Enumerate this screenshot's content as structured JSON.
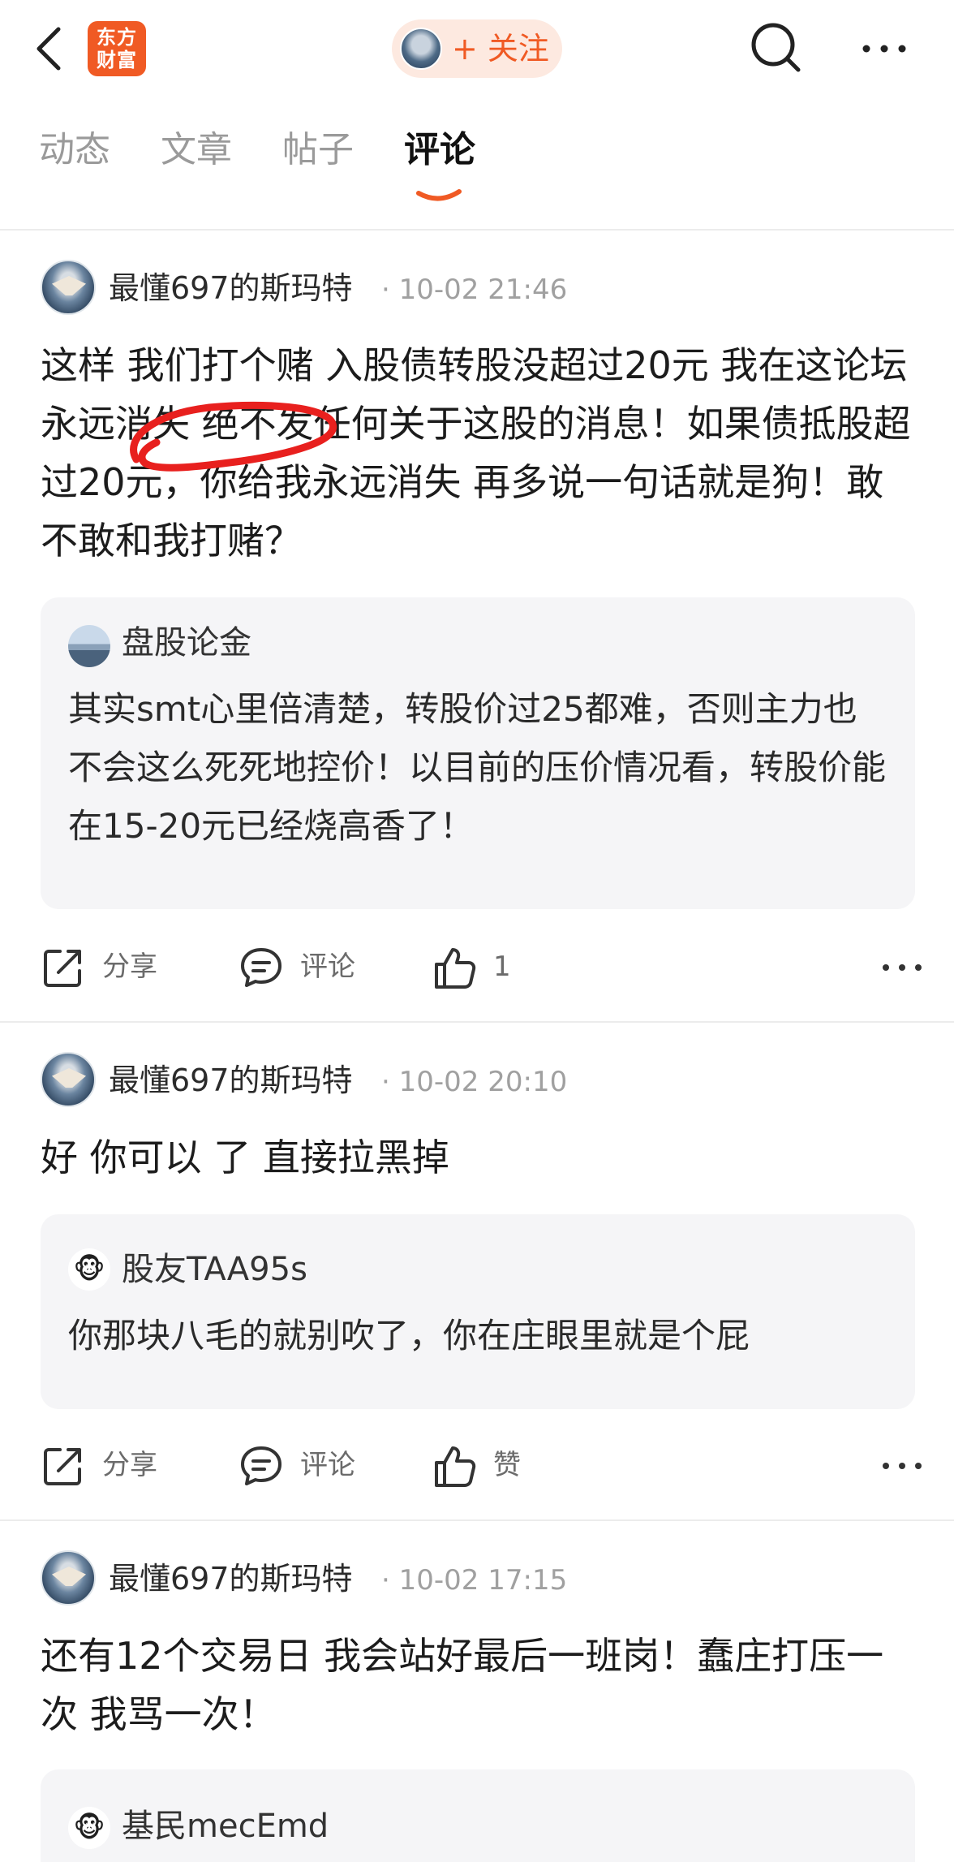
{
  "header": {
    "logo_text_line1": "东方",
    "logo_text_line2": "财富",
    "follow_label": "+ 关注"
  },
  "tabs": [
    {
      "label": "动态"
    },
    {
      "label": "文章"
    },
    {
      "label": "帖子"
    },
    {
      "label": "评论",
      "active": true
    }
  ],
  "posts": [
    {
      "author": "最懂697的斯玛特",
      "time": "· 10-02 21:46",
      "body": "这样 我们打个赌 入股债转股没超过20元 我在这论坛永远消失 绝不发任何关于这股的消息！如果债抵股超过20元，你给我永远消失 再多说一句话就是狗！敢不敢和我打赌？",
      "quote": {
        "author": "盘股论金",
        "text": "其实smt心里倍清楚，转股价过25都难，否则主力也不会这么死死地控价！以目前的压价情况看，转股价能在15-20元已经烧高香了！"
      },
      "share": "分享",
      "comment": "评论",
      "like": "1"
    },
    {
      "author": "最懂697的斯玛特",
      "time": "· 10-02 20:10",
      "body": "好 你可以 了 直接拉黑掉",
      "quote": {
        "author": "股友TAA95s",
        "text": "你那块八毛的就别吹了，你在庄眼里就是个屁"
      },
      "share": "分享",
      "comment": "评论",
      "like": "赞"
    },
    {
      "author": "最懂697的斯玛特",
      "time": "· 10-02 17:15",
      "body": "还有12个交易日 我会站好最后一班岗！蠢庄打压一次 我骂一次！",
      "quote": {
        "author": "基民mecEmd"
      }
    }
  ],
  "colors": {
    "accent": "#f05a24",
    "annotation_red": "#e8201e",
    "quote_bg": "#f5f5f7"
  },
  "icons": [
    "back-arrow-icon",
    "search-icon",
    "more-icon",
    "share-icon",
    "comment-icon",
    "like-icon"
  ]
}
